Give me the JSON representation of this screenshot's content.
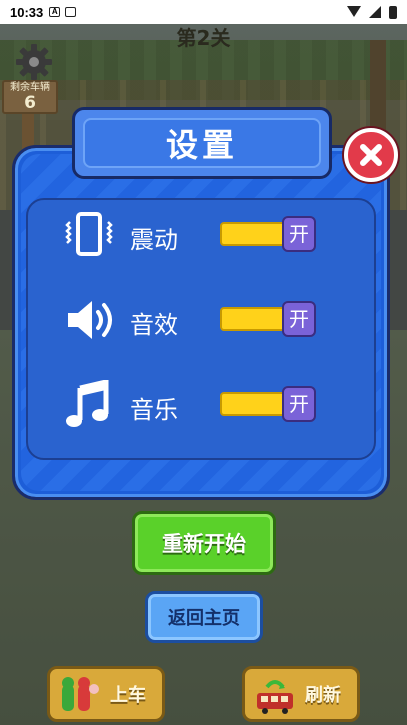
{
  "status_bar": {
    "time": "10:33"
  },
  "hud": {
    "level_title": "第2关",
    "remaining_label": "剩余车辆",
    "remaining_count": "6"
  },
  "settings": {
    "title": "设置",
    "rows": [
      {
        "label": "震动",
        "icon": "vibrate-icon",
        "toggle_text": "开",
        "on": true
      },
      {
        "label": "音效",
        "icon": "speaker-icon",
        "toggle_text": "开",
        "on": true
      },
      {
        "label": "音乐",
        "icon": "music-note-icon",
        "toggle_text": "开",
        "on": true
      }
    ]
  },
  "buttons": {
    "restart": "重新开始",
    "home": "返回主页",
    "board": "上车",
    "refresh": "刷新"
  },
  "colors": {
    "panel_blue": "#1d5ed8",
    "toggle_yellow": "#ffd21a",
    "toggle_knob": "#7a63d8",
    "close_red": "#e23a4a",
    "restart_green": "#5ad12a",
    "home_blue": "#5aa5f5"
  }
}
